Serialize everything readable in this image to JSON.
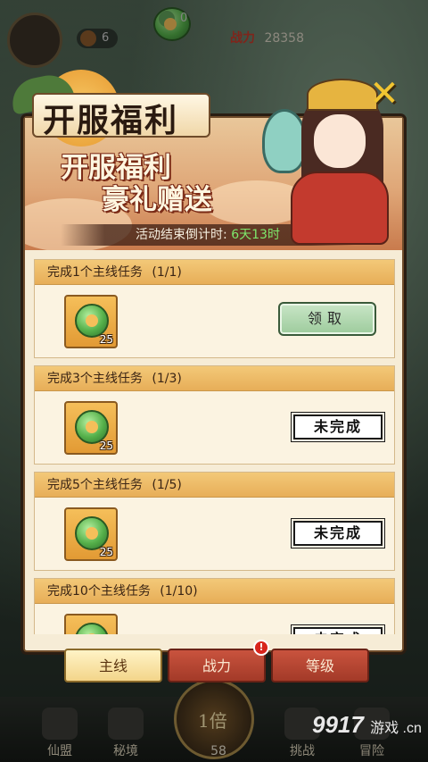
{
  "hud": {
    "copper_count": "6",
    "jade_count": "0",
    "power_label": "战力",
    "power_value": "28358"
  },
  "popup": {
    "title": "开服福利",
    "subtitle_line1": "开服福利",
    "subtitle_line2": "豪礼赠送",
    "countdown_label": "活动结束倒计时: ",
    "countdown_value": "6天13时"
  },
  "tasks": [
    {
      "title": "完成1个主线任务",
      "progress": "(1/1)",
      "reward_icon": "jade-icon",
      "reward_count": "25",
      "status": "claimable",
      "action_label": "领取"
    },
    {
      "title": "完成3个主线任务",
      "progress": "(1/3)",
      "reward_icon": "jade-icon",
      "reward_count": "25",
      "status": "incomplete",
      "action_label": "未完成"
    },
    {
      "title": "完成5个主线任务",
      "progress": "(1/5)",
      "reward_icon": "jade-icon",
      "reward_count": "25",
      "status": "incomplete",
      "action_label": "未完成"
    },
    {
      "title": "完成10个主线任务",
      "progress": "(1/10)",
      "reward_icon": "jade-icon",
      "reward_count": "",
      "status": "incomplete",
      "action_label": "未完成"
    }
  ],
  "tabs": [
    {
      "label": "主线",
      "active": true
    },
    {
      "label": "战力",
      "active": false,
      "badge": "!"
    },
    {
      "label": "等级",
      "active": false
    }
  ],
  "bottom_nav": {
    "items": [
      "仙盟",
      "秘境",
      "挑战",
      "冒险"
    ],
    "center_label": "1倍",
    "center_count": "58"
  },
  "watermark": {
    "main": "9917",
    "sub": "游戏 .cn"
  },
  "colors": {
    "popup_bg": "#f6ecd6",
    "header_gold": "#e7ae58",
    "tab_active": "#f3d58a",
    "tab_inactive": "#a33a28",
    "claim_green": "#9dcb9c",
    "countdown_green": "#7ee86c"
  }
}
